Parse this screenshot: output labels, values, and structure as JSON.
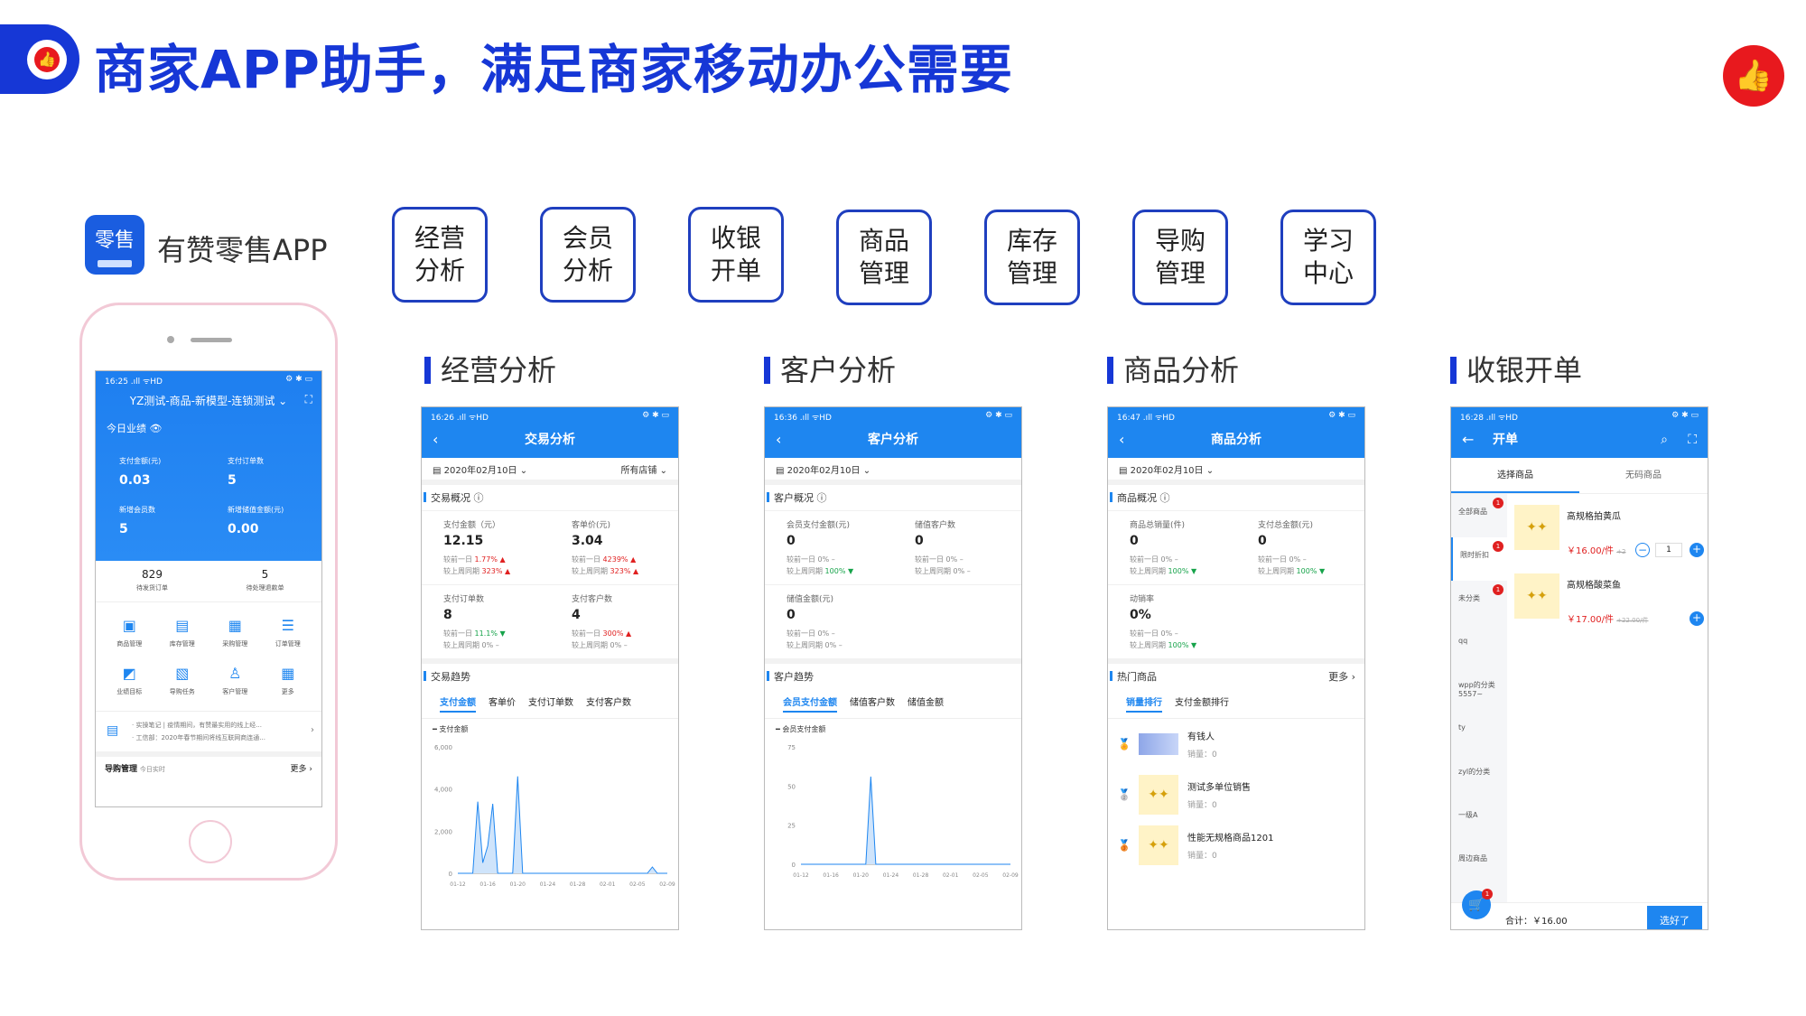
{
  "header": {
    "title": "商家APP助手，满足商家移动办公需要",
    "thumb_icon": "thumbs-up-icon",
    "accent": "#1637d6",
    "badge_color": "#e8191e"
  },
  "app": {
    "logo_text": "零售",
    "name": "有赞零售APP"
  },
  "features": [
    {
      "line1": "经营",
      "line2": "分析"
    },
    {
      "line1": "会员",
      "line2": "分析"
    },
    {
      "line1": "收银",
      "line2": "开单"
    },
    {
      "line1": "商品",
      "line2": "管理"
    },
    {
      "line1": "库存",
      "line2": "管理"
    },
    {
      "line1": "导购",
      "line2": "管理"
    },
    {
      "line1": "学习",
      "line2": "中心"
    }
  ],
  "sections": [
    "经营分析",
    "客户分析",
    "商品分析",
    "收银开单"
  ],
  "phone_home": {
    "status_time": "16:25 .ıll ᯤHD",
    "status_right": "⚙ ✱ ▭",
    "store": "YZ测试-商品-新模型-连锁测试 ⌄",
    "today_label": "今日业绩 👁",
    "kpis": [
      {
        "label": "支付金额(元)",
        "value": "0.03"
      },
      {
        "label": "支付订单数",
        "value": "5"
      },
      {
        "label": "新增会员数",
        "value": "5"
      },
      {
        "label": "新增储值金额(元)",
        "value": "0.00"
      }
    ],
    "counts": [
      {
        "value": "829",
        "label": "待发货订单"
      },
      {
        "value": "5",
        "label": "待处理退款单"
      }
    ],
    "icons": [
      {
        "label": "商品管理",
        "glyph": "▣"
      },
      {
        "label": "库存管理",
        "glyph": "▤"
      },
      {
        "label": "采购管理",
        "glyph": "▦"
      },
      {
        "label": "订单管理",
        "glyph": "☰"
      },
      {
        "label": "业绩目标",
        "glyph": "◩"
      },
      {
        "label": "导购任务",
        "glyph": "▧"
      },
      {
        "label": "客户管理",
        "glyph": "♙"
      },
      {
        "label": "更多",
        "glyph": "▦"
      }
    ],
    "news": [
      "· 实操笔记 | 疫情期间，有赞最实用的线上经...",
      "· 工信部：2020年春节期间将线互联网商连通..."
    ],
    "footer_left": "导购管理",
    "footer_sub": "今日实时",
    "footer_right": "更多 ›"
  },
  "phone_trade": {
    "status_time": "16:26 .ıll ᯤHD",
    "title": "交易分析",
    "date": "2020年02月10日 ⌄",
    "store": "所有店铺 ⌄",
    "overview": "交易概况 ⓘ",
    "cells": [
      {
        "label": "支付金额（元）",
        "value": "12.15",
        "c1": "1.77%",
        "c1d": "▲",
        "c2": "323%",
        "c2d": "▲"
      },
      {
        "label": "客单价(元)",
        "value": "3.04",
        "c1": "4239%",
        "c1d": "▲",
        "c2": "323%",
        "c2d": "▲"
      },
      {
        "label": "支付订单数",
        "value": "8",
        "c1": "11.1%",
        "c1d": "▼",
        "c2": "0%",
        "c2d": "–"
      },
      {
        "label": "支付客户数",
        "value": "4",
        "c1": "300%",
        "c1d": "▲",
        "c2": "0%",
        "c2d": "–"
      }
    ],
    "cmp1": "较前一日",
    "cmp2": "较上周同期",
    "trend": "交易趋势",
    "tabs": [
      "支付金额",
      "客单价",
      "支付订单数",
      "支付客户数"
    ],
    "legend": "━ 支付金额"
  },
  "phone_customer": {
    "status_time": "16:36 .ıll ᯤHD",
    "title": "客户分析",
    "date": "2020年02月10日 ⌄",
    "overview": "客户概况 ⓘ",
    "cells": [
      {
        "label": "会员支付金额(元)",
        "value": "0",
        "c1": "0%",
        "c1d": "–",
        "c2": "100%",
        "c2d": "▼"
      },
      {
        "label": "储值客户数",
        "value": "0",
        "c1": "0%",
        "c1d": "–",
        "c2": "0%",
        "c2d": "–"
      },
      {
        "label": "储值金额(元)",
        "value": "0",
        "c1": "0%",
        "c1d": "–",
        "c2": "0%",
        "c2d": "–"
      }
    ],
    "cmp1": "较前一日",
    "cmp2": "较上周同期",
    "trend": "客户趋势",
    "tabs": [
      "会员支付金额",
      "储值客户数",
      "储值金额"
    ],
    "legend": "━ 会员支付金额"
  },
  "phone_goods": {
    "status_time": "16:47 .ıll ᯤHD",
    "title": "商品分析",
    "date": "2020年02月10日 ⌄",
    "overview": "商品概况 ⓘ",
    "cells": [
      {
        "label": "商品总销量(件)",
        "value": "0",
        "c1": "0%",
        "c1d": "–",
        "c2": "100%",
        "c2d": "▼"
      },
      {
        "label": "支付总金额(元)",
        "value": "0",
        "c1": "0%",
        "c1d": "–",
        "c2": "100%",
        "c2d": "▼"
      },
      {
        "label": "动销率",
        "value": "0%",
        "c1": "0%",
        "c1d": "–",
        "c2": "100%",
        "c2d": "▼"
      }
    ],
    "cmp1": "较前一日",
    "cmp2": "较上周同期",
    "hot": "热门商品",
    "more": "更多 ›",
    "tabs": [
      "销量排行",
      "支付金额排行"
    ],
    "items": [
      {
        "name": "有钱人",
        "sales": "销量：0",
        "medal": "🏅"
      },
      {
        "name": "测试多单位销售",
        "sales": "销量：0",
        "medal": "🥈"
      },
      {
        "name": "性能无规格商品1201",
        "sales": "销量：0",
        "medal": "🥉"
      }
    ]
  },
  "phone_cashier": {
    "status_time": "16:28 .ıll ᯤHD",
    "title": "开单",
    "tabs": [
      "选择商品",
      "无码商品"
    ],
    "side": [
      {
        "label": "全部商品",
        "badge": "1"
      },
      {
        "label": "限时折扣",
        "badge": "1"
      },
      {
        "label": "未分类",
        "badge": "1"
      },
      {
        "label": "qq",
        "badge": ""
      },
      {
        "label": "wpp的分类5557~",
        "badge": ""
      },
      {
        "label": "ty",
        "badge": ""
      },
      {
        "label": "zyl的分类",
        "badge": ""
      },
      {
        "label": "一级A",
        "badge": ""
      },
      {
        "label": "周边商品",
        "badge": ""
      }
    ],
    "products": [
      {
        "name": "高规格拍黄瓜",
        "price": "￥16.00/件",
        "old": "+2",
        "qty": "1"
      },
      {
        "name": "高规格酸菜鱼",
        "price": "￥17.00/件",
        "old": "+22.00/件",
        "qty": ""
      }
    ],
    "cart_badge": "1",
    "total": "合计：￥16.00",
    "button": "选好了"
  },
  "chart_data": [
    {
      "type": "area",
      "title": "",
      "series": [
        {
          "name": "支付金额",
          "values": [
            0,
            0,
            0,
            0,
            3400,
            500,
            1300,
            3300,
            0,
            0,
            0,
            0,
            4600,
            0,
            0,
            0,
            0,
            0,
            0,
            0,
            0,
            0,
            0,
            0,
            0,
            0,
            0,
            0,
            0,
            0,
            0,
            0,
            0,
            0,
            0,
            0,
            0,
            0,
            0,
            300,
            0,
            0,
            0
          ]
        }
      ],
      "x_tick_labels": [
        "01-12",
        "01-16",
        "01-20",
        "01-24",
        "01-28",
        "02-01",
        "02-05",
        "02-09"
      ],
      "y_tick_labels": [
        "0",
        "2,000",
        "4,000",
        "6,000"
      ],
      "ylim": [
        0,
        6000
      ],
      "color": "#1e86f0",
      "grid": false
    },
    {
      "type": "area",
      "title": "",
      "series": [
        {
          "name": "会员支付金额",
          "values": [
            0,
            0,
            0,
            0,
            0,
            0,
            0,
            0,
            0,
            0,
            0,
            0,
            0,
            0,
            56,
            0,
            0,
            0,
            0,
            0,
            0,
            0,
            0,
            0,
            0,
            0,
            0,
            0,
            0,
            0,
            0,
            0,
            0,
            0,
            0,
            0,
            0,
            0,
            0,
            0,
            0,
            0,
            0
          ]
        }
      ],
      "x_tick_labels": [
        "01-12",
        "01-16",
        "01-20",
        "01-24",
        "01-28",
        "02-01",
        "02-05",
        "02-09"
      ],
      "y_tick_labels": [
        "0",
        "25",
        "50",
        "75"
      ],
      "ylim": [
        0,
        75
      ],
      "color": "#1e86f0",
      "grid": false
    }
  ]
}
